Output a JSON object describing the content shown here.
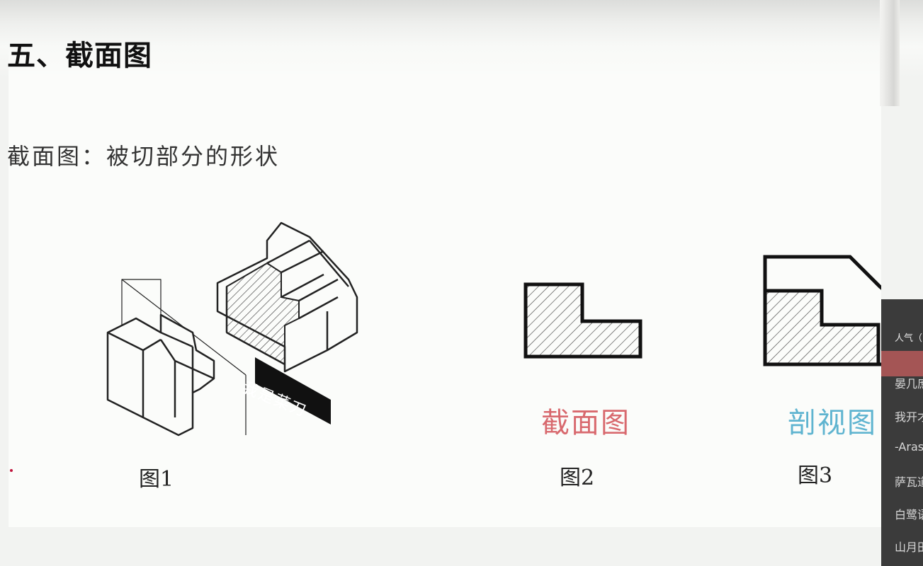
{
  "slide": {
    "title": "五、截面图",
    "subtitle": "截面图：被切部分的形状",
    "figure1": {
      "caption": "图1",
      "knife_label": "我是菜刀"
    },
    "figure2": {
      "caption": "图2",
      "label": "截面图"
    },
    "figure3": {
      "caption": "图3",
      "label": "剖视图"
    }
  },
  "chat_panel": {
    "header": "人气（",
    "items": [
      "晏几庶",
      "我开才",
      "-Aras",
      "萨瓦道",
      "白鹭语",
      "山月田"
    ]
  },
  "colors": {
    "label_red": "#d8696e",
    "label_blue": "#5fb4d0",
    "chat_bg": "#3b3b3b",
    "chat_highlight": "#a45555"
  }
}
